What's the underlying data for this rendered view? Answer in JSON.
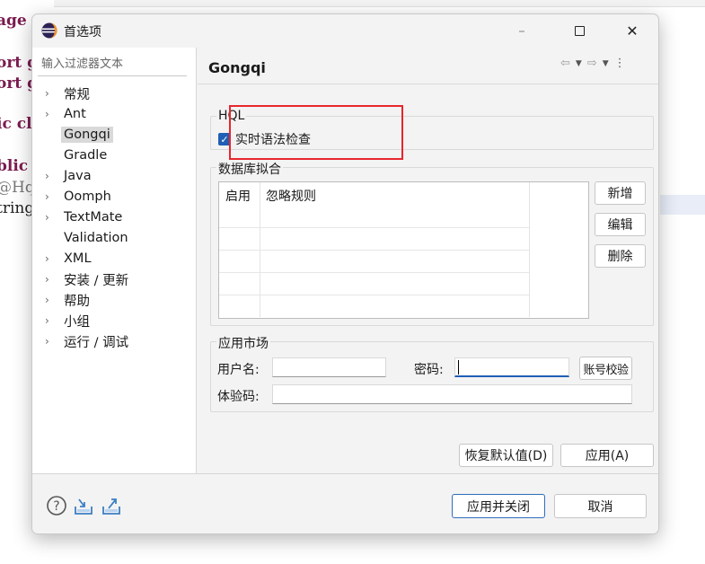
{
  "background_editor": {
    "lines": [
      "age",
      "ort g",
      "ort g",
      "ic cla",
      "blic v",
      "@Hql",
      "tring"
    ]
  },
  "dialog": {
    "title": "首选项",
    "filter_placeholder": "输入过滤器文本",
    "tree": [
      {
        "label": "常规",
        "expandable": true
      },
      {
        "label": "Ant",
        "expandable": true
      },
      {
        "label": "Gongqi",
        "expandable": false,
        "selected": true
      },
      {
        "label": "Gradle",
        "expandable": false
      },
      {
        "label": "Java",
        "expandable": true
      },
      {
        "label": "Oomph",
        "expandable": true
      },
      {
        "label": "TextMate",
        "expandable": true
      },
      {
        "label": "Validation",
        "expandable": false
      },
      {
        "label": "XML",
        "expandable": true
      },
      {
        "label": "安装 / 更新",
        "expandable": true
      },
      {
        "label": "帮助",
        "expandable": true
      },
      {
        "label": "小组",
        "expandable": true
      },
      {
        "label": "运行 / 调试",
        "expandable": true
      }
    ],
    "page_title": "Gongqi",
    "hql": {
      "group_title": "HQL",
      "checkbox_label": "实时语法检查",
      "checked": true
    },
    "db_fit": {
      "group_title": "数据库拟合",
      "columns": [
        "启用",
        "忽略规则"
      ],
      "rows": [],
      "buttons": {
        "add": "新增",
        "edit": "编辑",
        "delete": "删除"
      }
    },
    "market": {
      "group_title": "应用市场",
      "username_label": "用户名:",
      "username_value": "",
      "password_label": "密码:",
      "password_value": "",
      "verify_button": "账号校验",
      "trial_label": "体验码:",
      "trial_value": ""
    },
    "restore_defaults": "恢复默认值(D)",
    "apply": "应用(A)",
    "apply_close": "应用并关闭",
    "cancel": "取消",
    "colors": {
      "accent": "#1f5fb5",
      "highlight_box": "#e8262d",
      "keyword": "#7b1b4f"
    }
  }
}
